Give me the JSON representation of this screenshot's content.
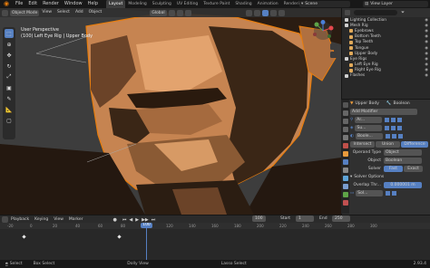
{
  "menubar": {
    "items": [
      "File",
      "Edit",
      "Render",
      "Window",
      "Help"
    ],
    "workspaces": [
      "Layout",
      "Modeling",
      "Sculpting",
      "UV Editing",
      "Texture Paint",
      "Shading",
      "Animation",
      "Rendering",
      "Composi"
    ],
    "active_workspace": "Layout",
    "scene": "Scene",
    "view_layer": "View Layer"
  },
  "viewport": {
    "mode": "Object Mode",
    "menus": [
      "View",
      "Select",
      "Add",
      "Object"
    ],
    "overlay_line1": "User Perspective",
    "overlay_line2": "(100) Left Eye Rig | Upper Body",
    "transform": "Global"
  },
  "outliner": {
    "rows": [
      {
        "label": "Lighting Collection",
        "color": "#d0d0d0"
      },
      {
        "label": "Mesh Rig",
        "color": "#d0d0d0"
      },
      {
        "label": "Eyebrows",
        "color": "#e0a95a"
      },
      {
        "label": "Bottom Teeth",
        "color": "#e0a95a"
      },
      {
        "label": "Top Teeth",
        "color": "#e0a95a"
      },
      {
        "label": "Tongue",
        "color": "#e0a95a"
      },
      {
        "label": "Upper Body",
        "color": "#e0a95a"
      },
      {
        "label": "Eye Rigs",
        "color": "#d0d0d0"
      },
      {
        "label": "Left Eye Rig",
        "color": "#e0a95a"
      },
      {
        "label": "Right Eye Rig",
        "color": "#e0a95a"
      },
      {
        "label": "Flashes",
        "color": "#d0d0d0"
      }
    ]
  },
  "properties": {
    "object_name": "Upper Body",
    "modifier_name": "Boolean",
    "add_modifier": "Add Modifier",
    "mod1": "Ar...",
    "mod2": "Su...",
    "mod3": "Boole...",
    "ops": [
      "Intersect",
      "Union",
      "Difference"
    ],
    "active_op": "Difference",
    "operand_type_label": "Operand Type",
    "operand_type": "Object",
    "object_label": "Object",
    "object_value": "Boolean",
    "solver_label": "Solver",
    "solver_opts": [
      "Fast",
      "Exact"
    ],
    "active_solver": "Fast",
    "solver_options": "Solver Options",
    "overlap_label": "Overlap Thr...",
    "overlap_value": "0.000001 m",
    "mod4": "Sol..."
  },
  "timeline": {
    "menus": [
      "Playback",
      "Keying",
      "View",
      "Marker"
    ],
    "current_frame": "100",
    "start_label": "Start",
    "start": "1",
    "end_label": "End",
    "end": "250",
    "ticks": [
      "-20",
      "0",
      "20",
      "40",
      "60",
      "80",
      "100",
      "120",
      "140",
      "160",
      "180",
      "200",
      "220",
      "240",
      "260",
      "280",
      "300"
    ]
  },
  "statusbar": {
    "items": [
      "Select",
      "Box Select",
      "Dolly View",
      "Lasso Select"
    ],
    "version": "2.93.4"
  },
  "colors": {
    "accent": "#5680c2",
    "orange": "#e87d0d",
    "skin": "#c68451"
  }
}
